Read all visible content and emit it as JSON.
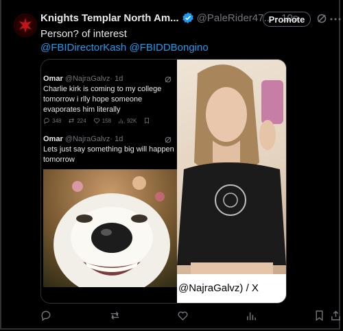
{
  "post": {
    "author_name": "Knights Templar North Am...",
    "author_handle": "@PaleRider47...",
    "time": "· 10s",
    "promote_label": "Promote",
    "text_line1": "Person? of interest",
    "mention1": "@FBIDirectorKash",
    "mention2": "@FBIDDBongino"
  },
  "quote1": {
    "name": "Omar",
    "handle": "@NajraGalvz",
    "time": "· 1d",
    "text": "Charlie kirk is coming to my college tomorrow i rlly hope someone evaporates him literally",
    "replies": "348",
    "reposts": "224",
    "likes": "158",
    "views": "92K"
  },
  "quote2": {
    "name": "Omar",
    "handle": "@NajraGalvz",
    "time": "· 1d",
    "text": "Lets just say something big will happen tomorrow"
  },
  "photo_caption": "@NajraGalvz) / X",
  "colors": {
    "accent": "#1d9bf0",
    "muted": "#71767b",
    "text": "#e7e9ea",
    "background": "#000000"
  },
  "icons": [
    "verified-badge-icon",
    "grok-icon",
    "more-icon",
    "reply-icon",
    "repost-icon",
    "like-icon",
    "views-icon",
    "bookmark-icon",
    "share-icon"
  ]
}
